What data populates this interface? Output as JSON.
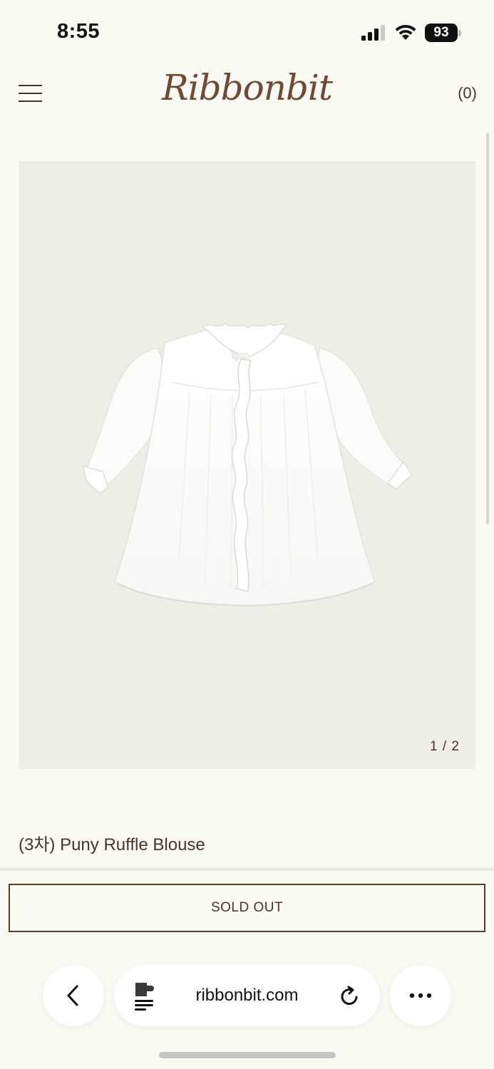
{
  "status_bar": {
    "time": "8:55",
    "battery": "93",
    "icons": [
      "signal-icon",
      "wifi-icon",
      "battery-icon"
    ]
  },
  "header": {
    "menu_icon": "hamburger-menu-icon",
    "logo_text": "Ribbonbit",
    "cart_count": "(0)"
  },
  "product": {
    "image_counter": "1 / 2",
    "title": "(3차) Puny Ruffle Blouse",
    "sold_out_label": "SOLD OUT"
  },
  "browser": {
    "url": "ribbonbit.com",
    "icons": [
      "back-chevron-icon",
      "page-reader-icon",
      "reload-icon",
      "more-dots-icon"
    ]
  }
}
